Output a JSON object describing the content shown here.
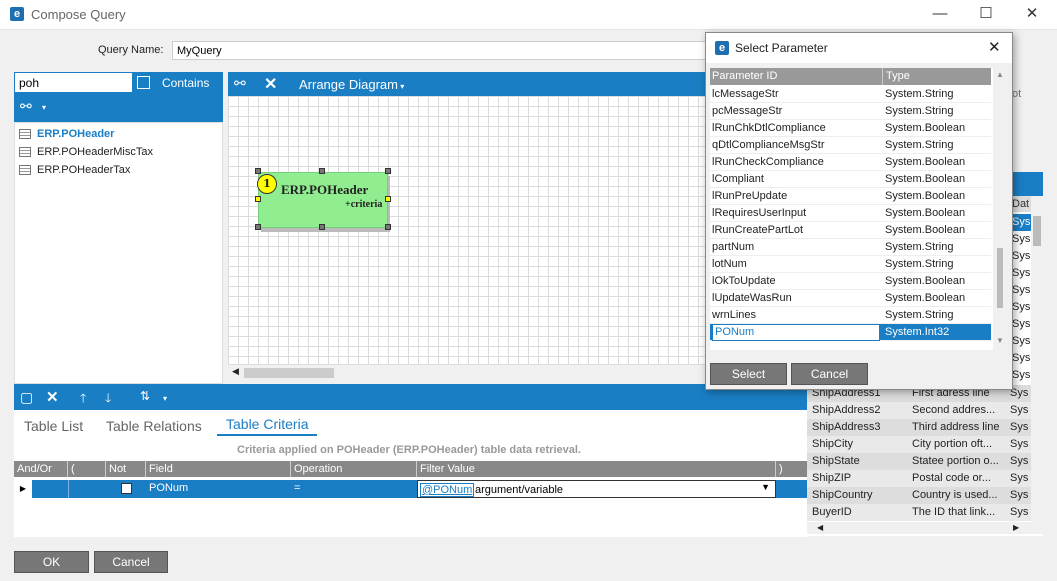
{
  "window": {
    "title": "Compose Query",
    "logo": "e",
    "minimize": "—",
    "maximize": "☐",
    "close": "✕"
  },
  "query": {
    "name_label": "Query Name:",
    "name_value": "MyQuery"
  },
  "search": {
    "value": "poh",
    "contains_label": "Contains"
  },
  "tree": {
    "items": [
      {
        "label": "ERP.POHeader",
        "selected": true
      },
      {
        "label": "ERP.POHeaderMiscTax",
        "selected": false
      },
      {
        "label": "ERP.POHeaderTax",
        "selected": false
      }
    ]
  },
  "diagram": {
    "arrange_label": "Arrange Diagram",
    "node_badge": "1",
    "node_title": "ERP.POHeader",
    "node_sub": "+criteria"
  },
  "tabs": [
    {
      "label": "Table List",
      "active": false
    },
    {
      "label": "Table Relations",
      "active": false
    },
    {
      "label": "Table Criteria",
      "active": true
    }
  ],
  "criteria": {
    "caption": "Criteria applied on POHeader (ERP.POHeader)  table data retrieval.",
    "columns": [
      "And/Or",
      "(",
      "Not",
      "Field",
      "Operation",
      "Filter Value",
      ")"
    ],
    "row": {
      "field": "PONum",
      "operation": "=",
      "filter_param": "@PONum",
      "filter_text": "argument/variable"
    }
  },
  "footer": {
    "ok_label": "OK",
    "cancel_label": "Cancel"
  },
  "right_panel": {
    "partial_text": "ot",
    "header_partial": "Dat",
    "rows": [
      {
        "field": "ShipAddress1",
        "desc": "First adress line",
        "type": "Sys"
      },
      {
        "field": "ShipAddress2",
        "desc": "Second addres...",
        "type": "Sys"
      },
      {
        "field": "ShipAddress3",
        "desc": "Third address line",
        "type": "Sys"
      },
      {
        "field": "ShipCity",
        "desc": "City portion oft...",
        "type": "Sys"
      },
      {
        "field": "ShipState",
        "desc": "Statee portion o...",
        "type": "Sys"
      },
      {
        "field": "ShipZIP",
        "desc": "Postal code or...",
        "type": "Sys"
      },
      {
        "field": "ShipCountry",
        "desc": "Country is used...",
        "type": "Sys"
      },
      {
        "field": "BuyerID",
        "desc": "The ID that link...",
        "type": "Sys"
      }
    ],
    "sys_above": [
      "Sys",
      "Sys",
      "Sys",
      "Sys",
      "Sys",
      "Sys",
      "Sys",
      "Sys",
      "Sys",
      "Sys",
      "Sys",
      "Sys"
    ]
  },
  "dialog": {
    "title": "Select Parameter",
    "col_id": "Parameter ID",
    "col_type": "Type",
    "params": [
      {
        "id": "lcMessageStr",
        "type": "System.String"
      },
      {
        "id": "pcMessageStr",
        "type": "System.String"
      },
      {
        "id": "lRunChkDtlCompliance",
        "type": "System.Boolean"
      },
      {
        "id": "qDtlComplianceMsgStr",
        "type": "System.String"
      },
      {
        "id": "lRunCheckCompliance",
        "type": "System.Boolean"
      },
      {
        "id": "lCompliant",
        "type": "System.Boolean"
      },
      {
        "id": "lRunPreUpdate",
        "type": "System.Boolean"
      },
      {
        "id": "lRequiresUserInput",
        "type": "System.Boolean"
      },
      {
        "id": "lRunCreatePartLot",
        "type": "System.Boolean"
      },
      {
        "id": "partNum",
        "type": "System.String"
      },
      {
        "id": "lotNum",
        "type": "System.String"
      },
      {
        "id": "lOkToUpdate",
        "type": "System.Boolean"
      },
      {
        "id": "lUpdateWasRun",
        "type": "System.Boolean"
      },
      {
        "id": "wrnLines",
        "type": "System.String"
      }
    ],
    "selected": {
      "id": "PONum",
      "type": "System.Int32"
    },
    "select_label": "Select",
    "cancel_label": "Cancel"
  }
}
